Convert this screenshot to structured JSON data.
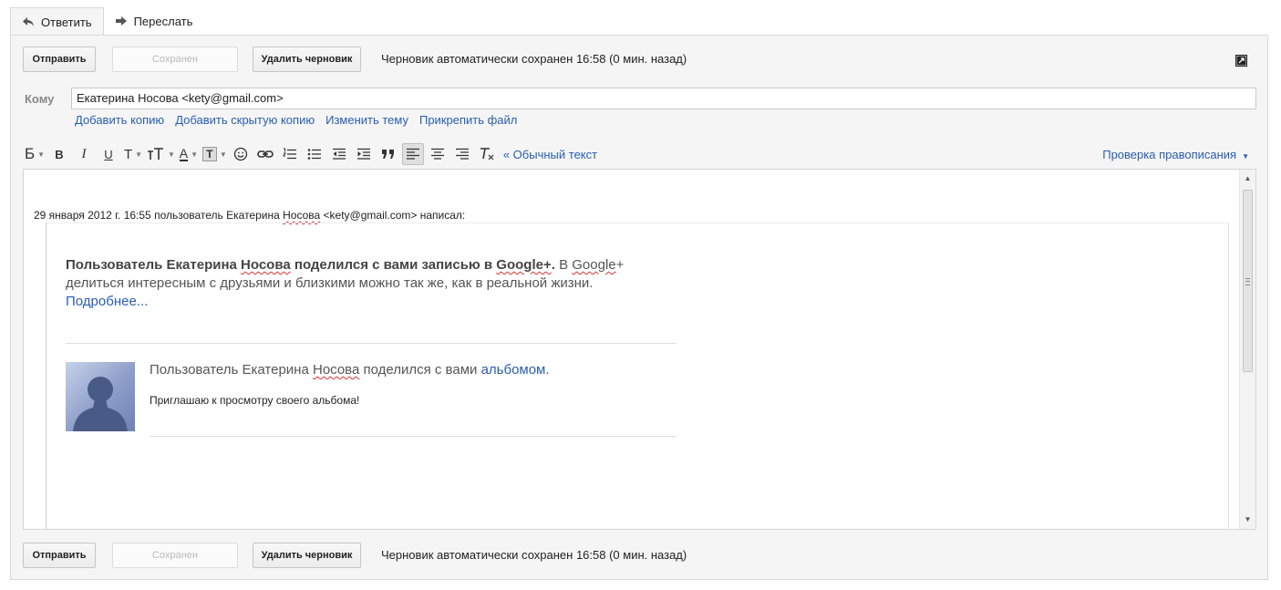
{
  "tabs": {
    "reply": "Ответить",
    "forward": "Переслать"
  },
  "actions": {
    "send": "Отправить",
    "saved": "Сохранен",
    "delete_draft": "Удалить черновик",
    "autosave_status": "Черновик автоматически сохранен 16:58 (0 мин. назад)"
  },
  "recipients": {
    "to_label": "Кому",
    "to_value": "Екатерина Носова <kety@gmail.com>",
    "add_cc": "Добавить копию",
    "add_bcc": "Добавить скрытую копию",
    "edit_subject": "Изменить тему",
    "attach_file": "Прикрепить файл"
  },
  "toolbar": {
    "font_label": "Б",
    "bold": "B",
    "italic": "I",
    "underline": "U",
    "font_size": "T",
    "text_color": "A",
    "bg_color": "T",
    "plain_text": "« Обычный текст",
    "spell_check": "Проверка правописания"
  },
  "message": {
    "quote_header_pre": "29 января 2012 г. 16:55 пользователь Екатерина ",
    "quote_header_name": "Носова",
    "quote_header_post": " <kety@gmail.com> написал:",
    "intro_bold_1": "Пользователь Екатерина ",
    "intro_bold_name": "Носова",
    "intro_bold_2": " поделился с вами записью в ",
    "intro_bold_gplus": "Google+",
    "intro_bold_dot": ".",
    "intro_text_1": " В ",
    "intro_text_google": "Google",
    "intro_text_2": "+ делиться интересным с друзьями и близкими можно так же, как в реальной жизни.",
    "more_link": "Подробнее...",
    "share_pre": "Пользователь Екатерина ",
    "share_name": "Носова",
    "share_mid": " поделился с вами ",
    "share_link": "альбомом",
    "share_post": ".",
    "invite_text": "Приглашаю к просмотру своего альбома!"
  },
  "colors": {
    "link": "#2a5db0",
    "panel_bg": "#f5f5f5",
    "border": "#d8d8d8"
  }
}
